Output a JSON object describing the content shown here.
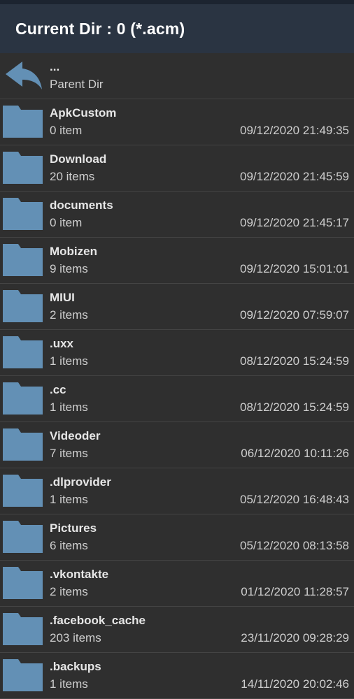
{
  "header": {
    "title": "Current Dir : 0 (*.acm)"
  },
  "parent": {
    "name": "...",
    "label": "Parent Dir",
    "icon": "back-arrow-icon"
  },
  "colors": {
    "folder": "#6390b5",
    "header_bg": "#2a3442",
    "list_bg": "#2f2f2f"
  },
  "items": [
    {
      "name": "ApkCustom",
      "count": "0 item",
      "date": "09/12/2020 21:49:35"
    },
    {
      "name": "Download",
      "count": "20 items",
      "date": "09/12/2020 21:45:59"
    },
    {
      "name": "documents",
      "count": "0 item",
      "date": "09/12/2020 21:45:17"
    },
    {
      "name": "Mobizen",
      "count": "9 items",
      "date": "09/12/2020 15:01:01"
    },
    {
      "name": "MIUI",
      "count": "2 items",
      "date": "09/12/2020 07:59:07"
    },
    {
      "name": ".uxx",
      "count": "1 items",
      "date": "08/12/2020 15:24:59"
    },
    {
      "name": ".cc",
      "count": "1 items",
      "date": "08/12/2020 15:24:59"
    },
    {
      "name": "Videoder",
      "count": "7 items",
      "date": "06/12/2020 10:11:26"
    },
    {
      "name": ".dlprovider",
      "count": "1 items",
      "date": "05/12/2020 16:48:43"
    },
    {
      "name": "Pictures",
      "count": "6 items",
      "date": "05/12/2020 08:13:58"
    },
    {
      "name": ".vkontakte",
      "count": "2 items",
      "date": "01/12/2020 11:28:57"
    },
    {
      "name": ".facebook_cache",
      "count": "203 items",
      "date": "23/11/2020 09:28:29"
    },
    {
      "name": ".backups",
      "count": "1 items",
      "date": "14/11/2020 20:02:46"
    }
  ]
}
